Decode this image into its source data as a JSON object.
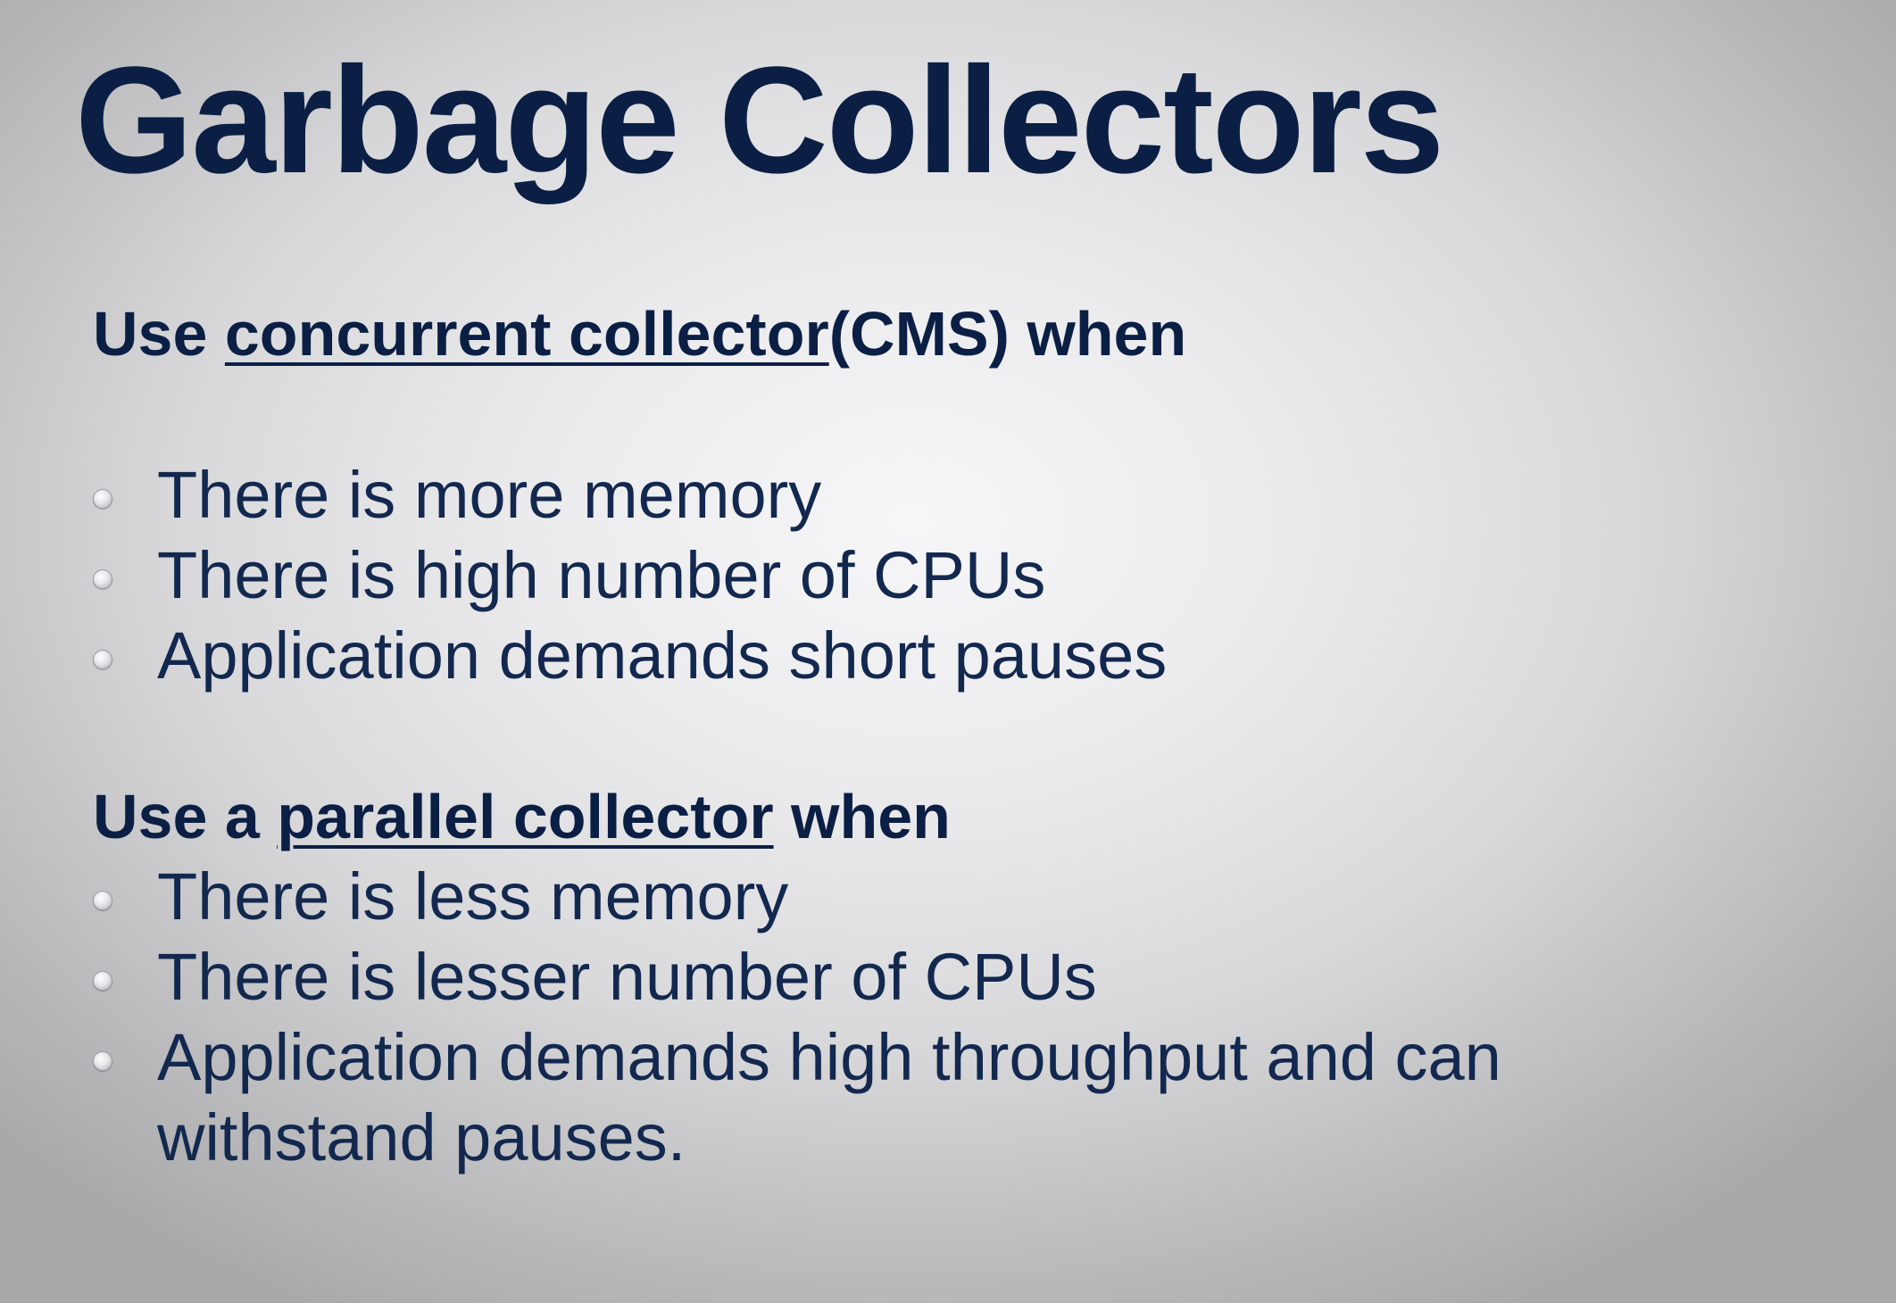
{
  "title": "Garbage Collectors",
  "sections": [
    {
      "heading": {
        "prefix": "Use ",
        "link": "concurrent collector",
        "suffix": "(CMS) when"
      },
      "bullets": [
        "There is more memory",
        "There is high number of CPUs",
        "Application demands short pauses"
      ]
    },
    {
      "heading": {
        "prefix": "Use a ",
        "link": "parallel collector",
        "suffix": " when"
      },
      "bullets": [
        "There is less memory",
        "There is lesser number of CPUs",
        "Application demands high throughput and can",
        "withstand pauses."
      ]
    }
  ],
  "colors": {
    "text": "#0b1f45",
    "background": "#e8e8ea"
  }
}
